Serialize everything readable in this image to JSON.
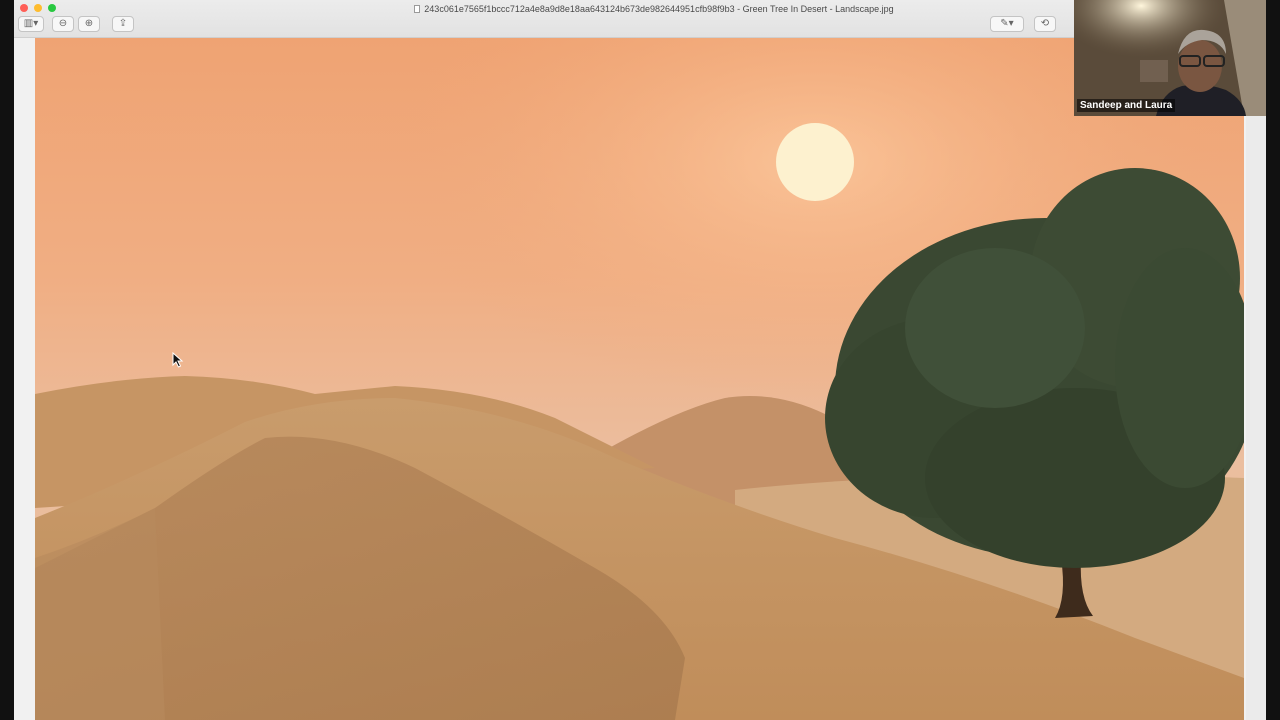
{
  "window": {
    "title": "243c061e7565f1bccc712a4e8a9d8e18aa643124b673de982644951cfb98f9b3 - Green Tree In Desert - Landscape.jpg"
  },
  "toolbar": {
    "sidebar_icon": "sidebar-icon",
    "zoom_out_icon": "zoom-out-icon",
    "zoom_in_icon": "zoom-in-icon",
    "share_icon": "share-icon",
    "markup_icon": "pen-icon",
    "rotate_icon": "rotate-icon"
  },
  "video_call": {
    "participant_name": "Sandeep and Laura"
  },
  "colors": {
    "sky_top": "#f0a878",
    "sky_bottom": "#e8b896",
    "sand": "#c89a66",
    "tree": "#3c4a34"
  }
}
